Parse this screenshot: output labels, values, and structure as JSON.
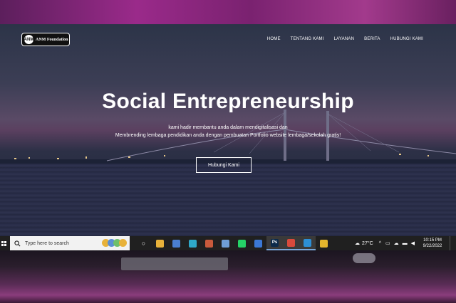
{
  "brand": {
    "logo_mark": "ANM",
    "name": "ANM Foundation"
  },
  "nav": {
    "items": [
      "HOME",
      "TENTANG KAMI",
      "LAYANAN",
      "BERITA",
      "HUBUNGI KAMI"
    ]
  },
  "hero": {
    "title": "Social Entrepreneurship",
    "line1": "kami hadir membantu anda dalam mendigitalisasi dan",
    "line2": "Membrending lembaga pendidikan anda dengan pembuatan Portfolio website lembaga/sekolah gratis!",
    "cta": "Hubungi Kami"
  },
  "taskbar": {
    "search_placeholder": "Type here to search",
    "apps": [
      {
        "icon": "task-view-icon",
        "glyph": "○",
        "color": "#202020"
      },
      {
        "icon": "file-explorer-icon",
        "glyph": "",
        "color": "#e8b23a"
      },
      {
        "icon": "store-icon",
        "glyph": "",
        "color": "#4a7fd1"
      },
      {
        "icon": "edge-icon",
        "glyph": "",
        "color": "#2fa8c8"
      },
      {
        "icon": "photos-icon",
        "glyph": "",
        "color": "#c85a3c"
      },
      {
        "icon": "onedrive-icon",
        "glyph": "",
        "color": "#6f9ed6"
      },
      {
        "icon": "whatsapp-icon",
        "glyph": "",
        "color": "#25d366"
      },
      {
        "icon": "mail-icon",
        "glyph": "",
        "color": "#3b78d4"
      },
      {
        "icon": "photoshop-icon",
        "glyph": "Ps",
        "color": "#0c2a4a"
      },
      {
        "icon": "chrome-dev-icon",
        "glyph": "",
        "color": "#d84a3c"
      },
      {
        "icon": "vscode-icon",
        "glyph": "",
        "color": "#2c8fd6"
      },
      {
        "icon": "chrome-icon",
        "glyph": "",
        "color": "#e4b62d"
      }
    ],
    "weather": "27°C",
    "time": "10:15 PM",
    "date": "9/22/2022"
  }
}
